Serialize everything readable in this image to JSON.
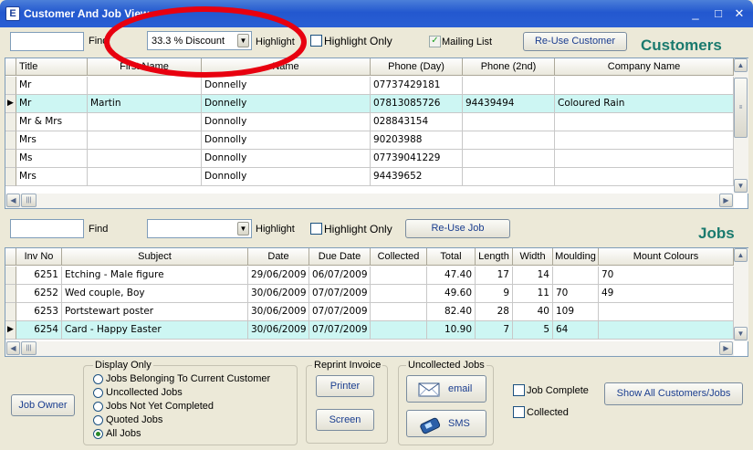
{
  "window": {
    "title": "Customer And Job View",
    "controls": [
      "_",
      "□",
      "✕"
    ]
  },
  "customers": {
    "find_label": "Find",
    "find_value": "",
    "highlight_value": "33.3 % Discount",
    "highlight_label": "Highlight",
    "highlight_only_label": "Highlight Only",
    "mailing_list_label": "Mailing List",
    "mailing_list_checked": true,
    "reuse_button": "Re-Use Customer",
    "section_title": "Customers",
    "columns": [
      "Title",
      "First Name",
      "Name",
      "Phone (Day)",
      "Phone (2nd)",
      "Company Name"
    ],
    "rows": [
      {
        "cells": [
          "Mr",
          "",
          "Donnelly",
          "07737429181",
          "",
          ""
        ],
        "selected": false
      },
      {
        "cells": [
          "Mr",
          "Martin",
          "Donnelly",
          "07813085726",
          "94439494",
          "Coloured Rain"
        ],
        "selected": true
      },
      {
        "cells": [
          "Mr & Mrs",
          "",
          "Donnolly",
          "028843154",
          "",
          ""
        ],
        "selected": false
      },
      {
        "cells": [
          "Mrs",
          "",
          "Donnolly",
          "90203988",
          "",
          ""
        ],
        "selected": false
      },
      {
        "cells": [
          "Ms",
          "",
          "Donnolly",
          "07739041229",
          "",
          ""
        ],
        "selected": false
      },
      {
        "cells": [
          "Mrs",
          "",
          "Donnolly",
          "94439652",
          "",
          ""
        ],
        "selected": false
      }
    ]
  },
  "jobs": {
    "find_label": "Find",
    "highlight_label": "Highlight",
    "highlight_only_label": "Highlight Only",
    "reuse_button": "Re-Use Job",
    "section_title": "Jobs",
    "columns": [
      "Inv No",
      "Subject",
      "Date",
      "Due Date",
      "Collected",
      "Total",
      "Length",
      "Width",
      "Moulding",
      "Mount Colours"
    ],
    "rows": [
      {
        "cells": [
          "6251",
          "Etching - Male figure",
          "29/06/2009",
          "06/07/2009",
          "",
          "47.40",
          "17",
          "14",
          "",
          "70"
        ],
        "selected": false
      },
      {
        "cells": [
          "6252",
          "Wed couple, Boy",
          "30/06/2009",
          "07/07/2009",
          "",
          "49.60",
          "9",
          "11",
          "70",
          "49"
        ],
        "selected": false
      },
      {
        "cells": [
          "6253",
          "Portstewart poster",
          "30/06/2009",
          "07/07/2009",
          "",
          "82.40",
          "28",
          "40",
          "109",
          ""
        ],
        "selected": false
      },
      {
        "cells": [
          "6254",
          "Card - Happy Easter",
          "30/06/2009",
          "07/07/2009",
          "",
          "10.90",
          "7",
          "5",
          "64",
          ""
        ],
        "selected": true
      }
    ]
  },
  "bottom": {
    "job_owner_button": "Job Owner",
    "display_only": {
      "label": "Display Only",
      "options": [
        "Jobs Belonging To Current Customer",
        "Uncollected Jobs",
        "Jobs Not Yet Completed",
        "Quoted Jobs",
        "All Jobs"
      ],
      "selected_index": 4
    },
    "reprint": {
      "label": "Reprint Invoice",
      "printer": "Printer",
      "screen": "Screen"
    },
    "uncollected": {
      "label": "Uncollected Jobs",
      "email": "email",
      "sms": "SMS"
    },
    "job_complete_label": "Job Complete",
    "collected_label": "Collected",
    "show_all_button": "Show All Customers/Jobs"
  },
  "colors": {
    "selected_row": "#cdf6f3",
    "section_title": "#1a7a6e",
    "titlebar": "#2358cf",
    "annotation": "#e8000f"
  }
}
